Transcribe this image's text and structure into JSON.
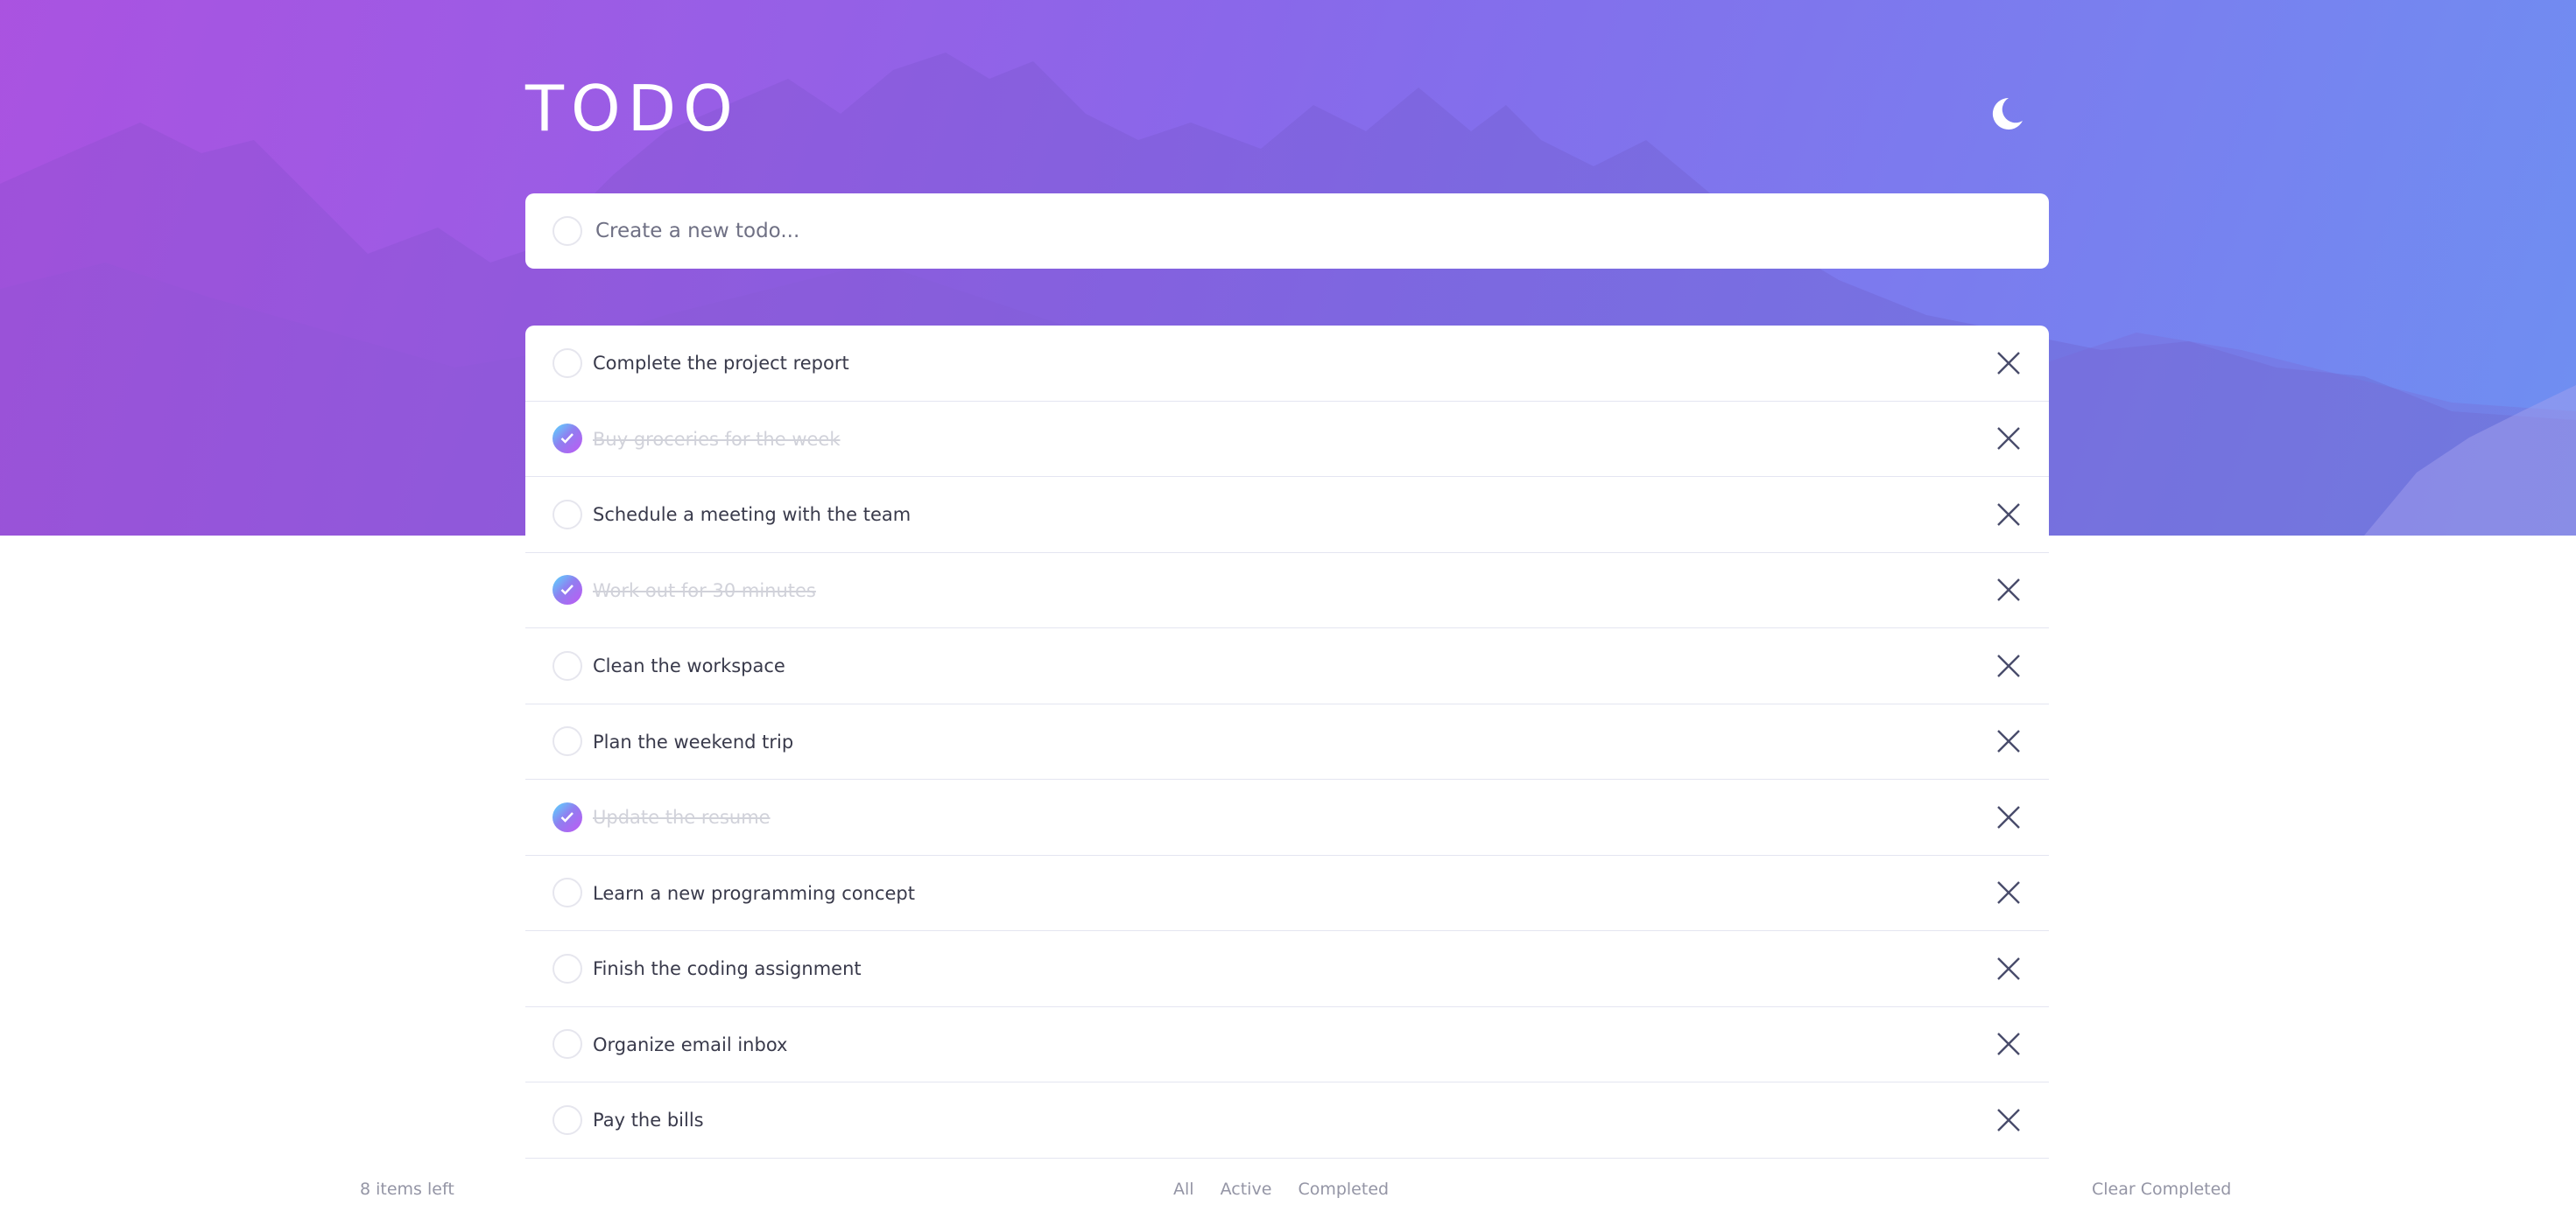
{
  "app": {
    "title": "TODO",
    "theme_icon": "moon-icon"
  },
  "new_todo": {
    "placeholder": "Create a new todo...",
    "value": ""
  },
  "todos": [
    {
      "text": "Complete the project report",
      "completed": false
    },
    {
      "text": "Buy groceries for the week",
      "completed": true
    },
    {
      "text": "Schedule a meeting with the team",
      "completed": false
    },
    {
      "text": "Work out for 30 minutes",
      "completed": true
    },
    {
      "text": "Clean the workspace",
      "completed": false
    },
    {
      "text": "Plan the weekend trip",
      "completed": false
    },
    {
      "text": "Update the resume",
      "completed": true
    },
    {
      "text": "Learn a new programming concept",
      "completed": false
    },
    {
      "text": "Finish the coding assignment",
      "completed": false
    },
    {
      "text": "Organize email inbox",
      "completed": false
    },
    {
      "text": "Pay the bills",
      "completed": false
    }
  ],
  "footer": {
    "items_left": "8 items left",
    "filters": [
      "All",
      "Active",
      "Completed"
    ],
    "clear_completed": "Clear Completed"
  },
  "colors": {
    "gradient_start": "#57ddff",
    "gradient_end": "#c058f3",
    "text": "#393a4b",
    "completed_text": "#d1d2da",
    "muted": "#9495a5"
  }
}
